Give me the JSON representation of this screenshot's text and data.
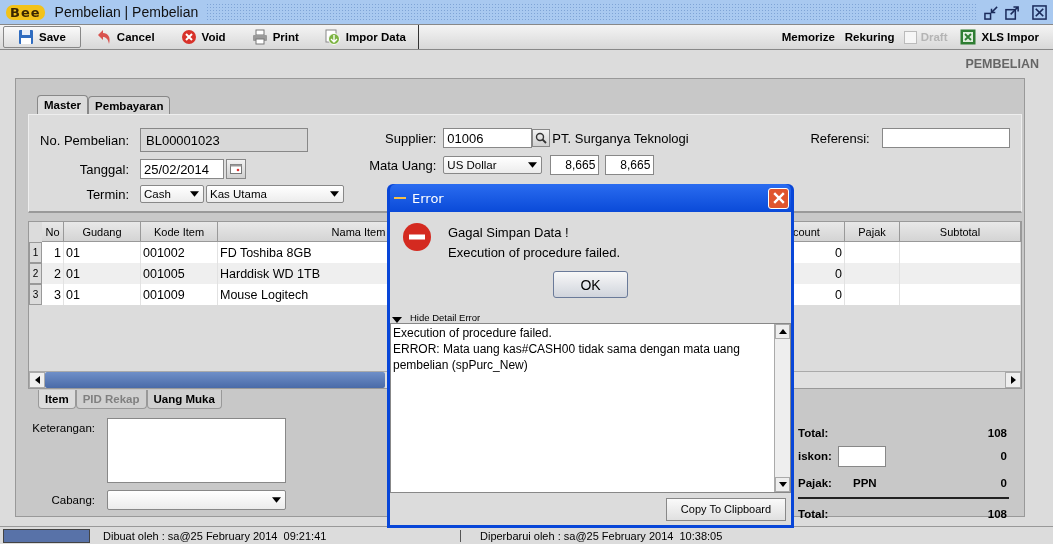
{
  "window": {
    "logo": "Bee",
    "title": "Pembelian | Pembelian"
  },
  "toolbar": {
    "buttons": [
      {
        "label": "Save",
        "kind": "save",
        "focused": true
      },
      {
        "label": "Cancel",
        "kind": "cancel",
        "focused": false
      },
      {
        "label": "Void",
        "kind": "void",
        "focused": false
      },
      {
        "label": "Print",
        "kind": "print",
        "focused": false
      },
      {
        "label": "Impor Data",
        "kind": "import",
        "focused": false
      }
    ],
    "memorize": "Memorize",
    "rekuring": "Rekuring",
    "draft": {
      "label": "Draft",
      "checked": false,
      "disabled": true
    },
    "xls": "XLS Impor"
  },
  "page_heading": "PEMBELIAN",
  "tabs": [
    {
      "label": "Master",
      "selected": true
    },
    {
      "label": "Pembayaran",
      "selected": false
    }
  ],
  "master": {
    "no_label": "No. Pembelian:",
    "no_value": "BL00001023",
    "tanggal_label": "Tanggal:",
    "tanggal_value": "25/02/2014",
    "termin_label": "Termin:",
    "termin_value": "Cash",
    "kas_value": "Kas Utama",
    "supplier_label": "Supplier:",
    "supplier_code": "01006",
    "supplier_name": "PT. Surganya Teknologi",
    "mata_uang_label": "Mata Uang:",
    "mata_uang_value": "US Dollar",
    "rate_1": "8,665",
    "rate_2": "8,665",
    "referensi_label": "Referensi:"
  },
  "table": {
    "columns": [
      "No",
      "Gudang",
      "Kode Item",
      "Nama Item",
      "count",
      "Pajak",
      "Subtotal"
    ],
    "rows": [
      {
        "header": "1",
        "no": "1",
        "gudang": "01",
        "kode_item": "001002",
        "nama_item": "FD Toshiba 8GB",
        "column_5": "0",
        "selected": false
      },
      {
        "header": "2",
        "no": "2",
        "gudang": "01",
        "kode_item": "001005",
        "nama_item": "Harddisk WD 1TB",
        "column_5": "0",
        "selected": true
      },
      {
        "header": "3",
        "no": "3",
        "gudang": "01",
        "kode_item": "001009",
        "nama_item": "Mouse Logitech",
        "column_5": "0",
        "selected": false
      }
    ]
  },
  "subtabs": [
    {
      "label": "Item",
      "selected": true,
      "disabled": false
    },
    {
      "label": "PID Rekap",
      "selected": false,
      "disabled": true
    },
    {
      "label": "Uang Muka",
      "selected": false,
      "disabled": false
    }
  ],
  "notes": {
    "keterangan_label": "Keterangan:",
    "cabang_label": "Cabang:"
  },
  "totals": [
    {
      "label": "Total:",
      "value": "108",
      "kind": "plain"
    },
    {
      "label": "iskon:",
      "value": "0",
      "kind": "input"
    },
    {
      "label": "Pajak:",
      "tax": "PPN",
      "value": "0",
      "kind": "tax"
    },
    {
      "label": "Total:",
      "value": "108",
      "kind": "grand"
    }
  ],
  "status_bar": {
    "created": "Dibuat oleh : sa@25 February 2014  09:21:41",
    "updated": "Diperbarui oleh : sa@25 February 2014  10:38:05"
  },
  "dialog": {
    "title": "Error",
    "heading": "Gagal Simpan Data !",
    "message": "Execution of procedure failed.",
    "ok": "OK",
    "detail_toggle": "Hide Detail Error",
    "expanded": true,
    "detail_lines": [
      "Execution of procedure failed.",
      "ERROR: Mata uang kas#CASH00 tidak sama dengan mata uang pembelian (spPurc_New)"
    ],
    "copy": "Copy To Clipboard"
  }
}
